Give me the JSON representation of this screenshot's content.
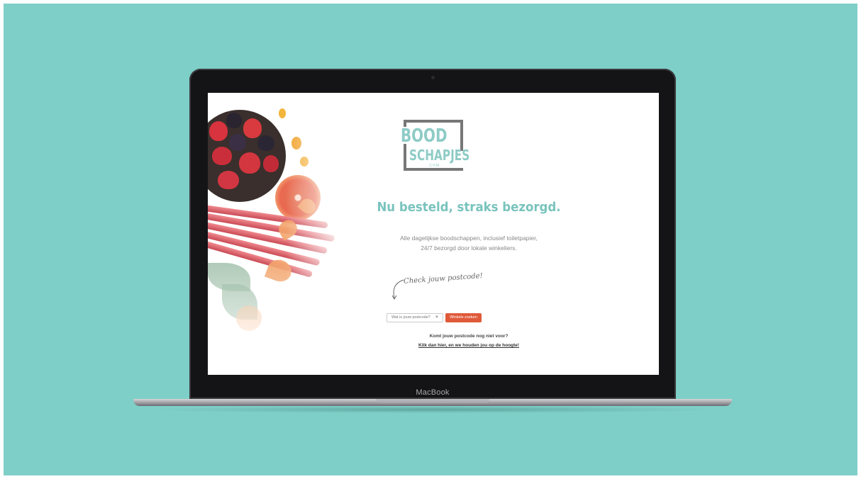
{
  "device": {
    "brand_label": "MacBook"
  },
  "colors": {
    "background": "#7ecfc8",
    "accent": "#79c3bd",
    "button": "#e05a3a"
  },
  "logo": {
    "line1": "BOOD",
    "line2": "SCHAPJES",
    "suffix": ".COM"
  },
  "hero": {
    "headline": "Nu besteld, straks bezorgd.",
    "subline1": "Alle dagelijkse boodschappen, inclusief toiletpapier,",
    "subline2": "24/7 bezorgd door lokale winkeliers."
  },
  "callout": {
    "text": "Check jouw postcode!"
  },
  "postcode_form": {
    "select_value": "Wat is jouw postcode?",
    "search_button": "Winkels zoeken"
  },
  "footer_note": {
    "question": "Komt jouw postcode nog niet voor?",
    "link": "Klik dan hier, en we houden jou op de hoogte!"
  }
}
